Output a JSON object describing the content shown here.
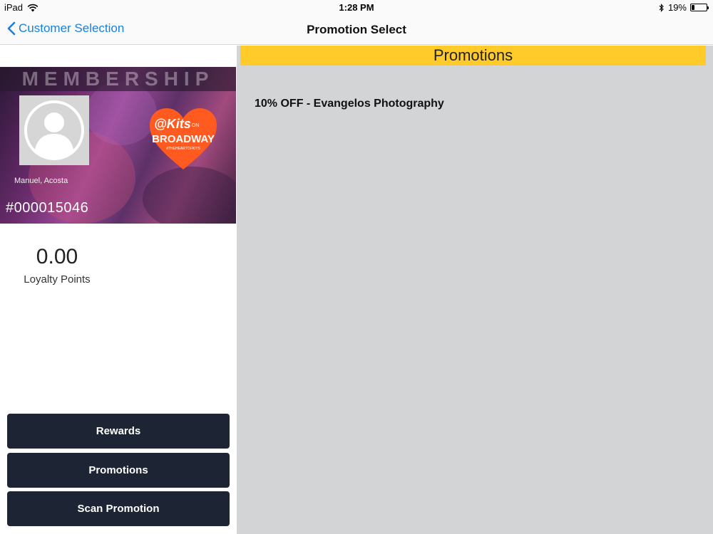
{
  "status_bar": {
    "device": "iPad",
    "time": "1:28 PM",
    "battery_percent": "19%",
    "battery_level": 0.19,
    "icons": [
      "wifi-icon",
      "bluetooth-icon",
      "battery-icon"
    ]
  },
  "nav": {
    "back_label": "Customer Selection",
    "title": "Promotion Select",
    "accent_color": "#1a80d9"
  },
  "card": {
    "heading": "MEMBERSHIP",
    "member_name": "Manuel, Acosta",
    "member_number": "#000015046",
    "logo": {
      "line1": "@Kits",
      "line1_suffix": "ON",
      "line2": "BROADWAY",
      "tagline": "#THEHEARTOFKITS",
      "color": "#ff5a1f"
    }
  },
  "loyalty": {
    "value": "0.00",
    "label": "Loyalty Points"
  },
  "buttons": {
    "rewards": "Rewards",
    "promotions": "Promotions",
    "scan_promotion": "Scan Promotion",
    "color": "#1d2433"
  },
  "promotions_panel": {
    "header": "Promotions",
    "header_color": "#ffcb2b",
    "items": [
      {
        "label": "10% OFF - Evangelos Photography"
      }
    ]
  }
}
